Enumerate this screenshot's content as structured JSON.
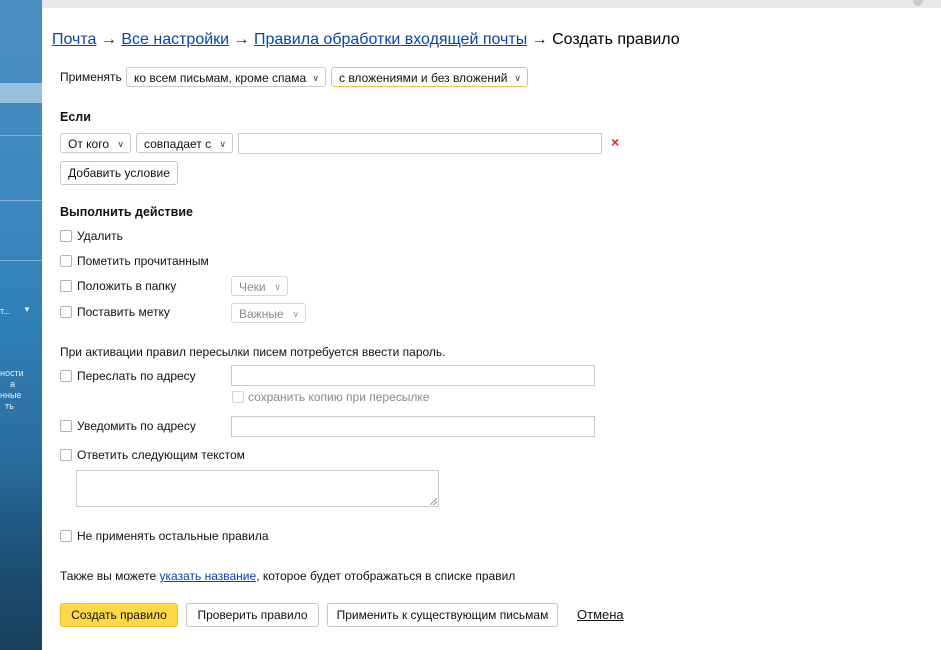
{
  "breadcrumb": {
    "mail": "Почта",
    "all_settings": "Все настройки",
    "incoming_rules": "Правила обработки входящей почты",
    "current": "Создать правило",
    "separator": "→"
  },
  "apply": {
    "label": "Применять",
    "scope_value": "ко всем письмам, кроме спама",
    "attachments_value": "с вложениями и без вложений"
  },
  "conditions": {
    "heading": "Если",
    "field_value": "От кого",
    "operator_value": "совпадает с",
    "match_value": "",
    "remove_icon": "×",
    "add_condition_label": "Добавить условие"
  },
  "actions": {
    "heading": "Выполнить действие",
    "delete_label": "Удалить",
    "mark_read_label": "Пометить прочитанным",
    "move_to_folder_label": "Положить в папку",
    "folder_value": "Чеки",
    "set_label_label": "Поставить метку",
    "tag_value": "Важные"
  },
  "forward": {
    "password_note": "При активации правил пересылки писем потребуется ввести пароль.",
    "forward_label": "Переслать по адресу",
    "forward_value": "",
    "keep_copy_label": "сохранить копию при пересылке",
    "notify_label": "Уведомить по адресу",
    "notify_value": "",
    "reply_label": "Ответить следующим текстом",
    "reply_value": ""
  },
  "stop_label": "Не применять остальные правила",
  "name_hint": {
    "before": "Также вы можете ",
    "link": "указать название",
    "after": ", которое будет отображаться в списке правил"
  },
  "buttons": {
    "create": "Создать правило",
    "check": "Проверить правило",
    "apply_existing": "Применить к существующим письмам",
    "cancel": "Отмена"
  },
  "sidebar_fragments": {
    "item_truncated": "т...",
    "text_block": "ности\n    а\nнные\n  ть",
    "arrow": "▼"
  },
  "colors": {
    "link": "#0b43a8",
    "primary_button": "#fed847",
    "focus_border": "#f3c53d",
    "remove_icon": "#e02a1d"
  }
}
